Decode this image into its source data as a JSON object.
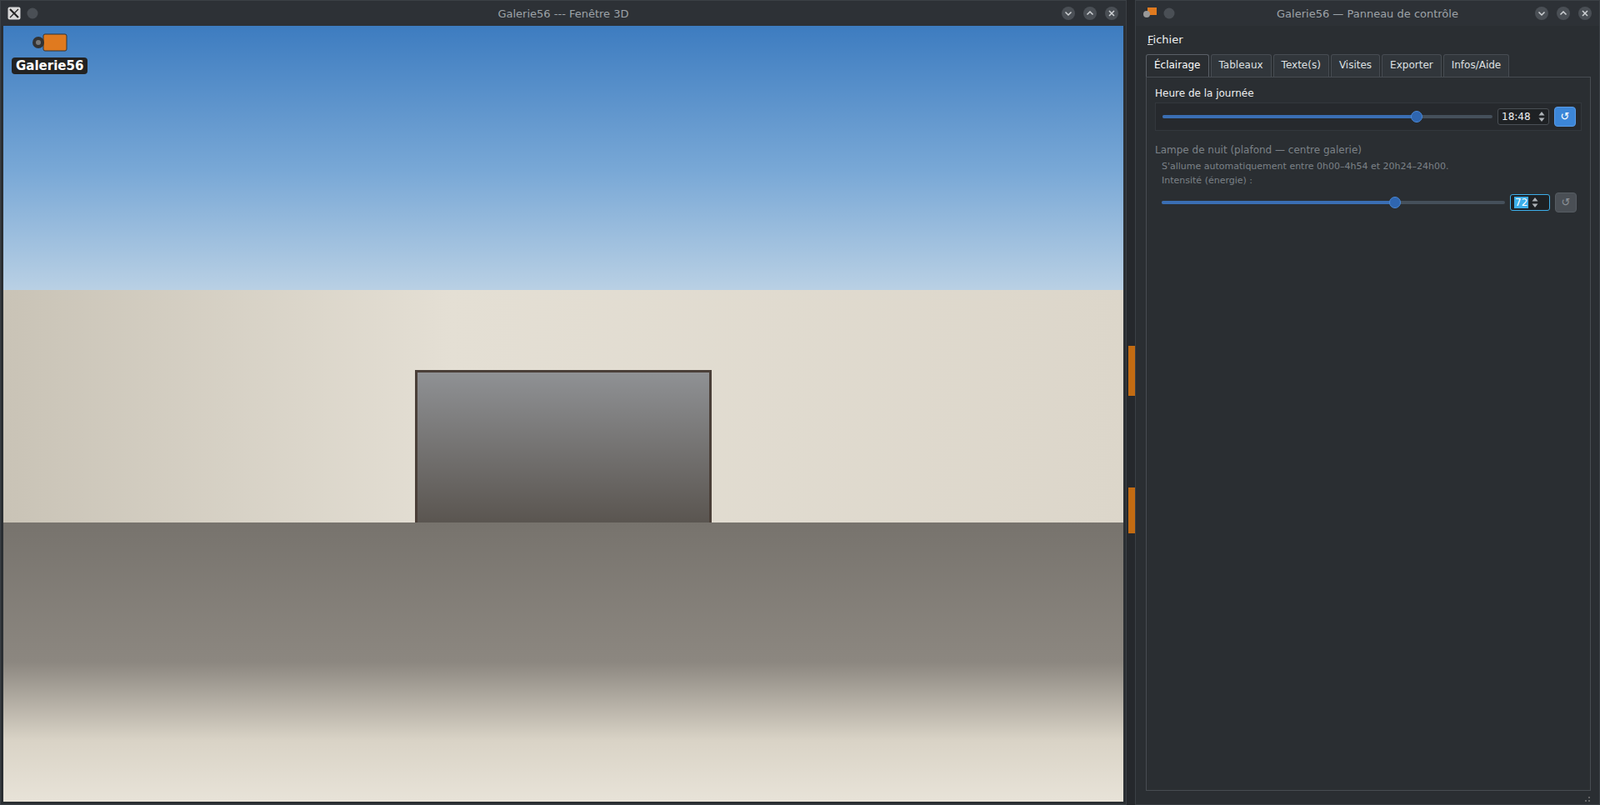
{
  "scene_window": {
    "title": "Galerie56 --- Fenêtre 3D",
    "logo": "Galerie56"
  },
  "control_window": {
    "title": "Galerie56 — Panneau de contrôle"
  },
  "menu": [
    {
      "label": "Fichier"
    }
  ],
  "tabs": [
    {
      "label": "Éclairage",
      "selected": true
    },
    {
      "label": "Tableaux",
      "selected": false
    },
    {
      "label": "Texte(s)",
      "selected": false
    },
    {
      "label": "Visites",
      "selected": false
    },
    {
      "label": "Exporter",
      "selected": false
    },
    {
      "label": "Infos/Aide",
      "selected": false
    }
  ],
  "time": {
    "label": "Heure de la journée",
    "level": 0.77,
    "value": "18:48",
    "reset": "↺",
    "reset_disabled": false
  },
  "night_lamp": {
    "title": "Lampe de nuit (plafond — centre galerie)",
    "note": "S'allume automatiquement entre 0h00–4h54 et 20h24–24h00.",
    "disabled": true,
    "intensity": {
      "label": "Intensité (énergie) :",
      "level": 0.68,
      "value": "72",
      "focused": true,
      "reset": "↺",
      "reset_disabled": true
    }
  }
}
